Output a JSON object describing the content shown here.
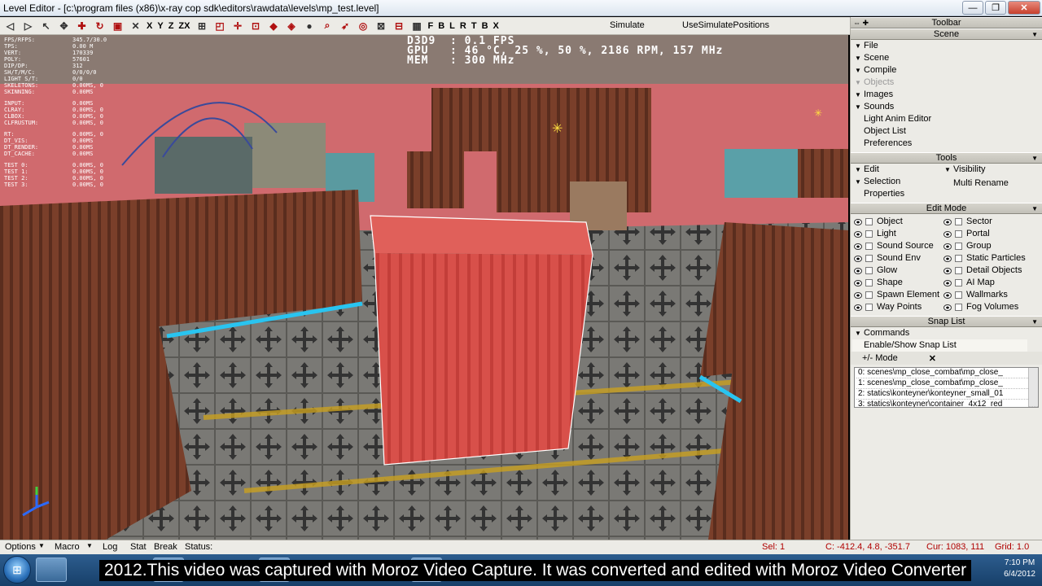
{
  "window": {
    "title": "Level Editor - [c:\\program files (x86)\\x-ray cop sdk\\editors\\rawdata\\levels\\mp_test.level]",
    "minimize": "—",
    "maximize": "❐",
    "close": "✕"
  },
  "toolbar": {
    "axis_letters": [
      "X",
      "Y",
      "Z",
      "ZX"
    ],
    "snap_letters": [
      "F",
      "B",
      "L",
      "R",
      "T",
      "B",
      "X"
    ],
    "simulate": "Simulate",
    "use_simulate_positions": "UseSimulatePositions"
  },
  "stats": {
    "rows": [
      {
        "k": "FPS/RFPS:",
        "v": "345.7/30.0"
      },
      {
        "k": "TPS:",
        "v": "0.00 M"
      },
      {
        "k": "VERT:",
        "v": "170339"
      },
      {
        "k": "POLY:",
        "v": "57601"
      },
      {
        "k": "DIP/DP:",
        "v": "312"
      },
      {
        "k": "SH/T/M/C:",
        "v": "0/0/0/0"
      },
      {
        "k": "LIGHT S/T:",
        "v": "0/0"
      },
      {
        "k": "SKELETONS:",
        "v": "0.00MS, 0"
      },
      {
        "k": "SKINNING:",
        "v": "0.00MS"
      },
      {
        "k": "INPUT:",
        "v": "0.00MS",
        "gap": true
      },
      {
        "k": "CLRAY:",
        "v": "0.00MS, 0"
      },
      {
        "k": "CLBOX:",
        "v": "0.00MS, 0"
      },
      {
        "k": "CLFRUSTUM:",
        "v": "0.00MS, 0"
      },
      {
        "k": " RT:",
        "v": "0.00MS, 0",
        "gap": true
      },
      {
        "k": " DT_VIS:",
        "v": "0.00MS"
      },
      {
        "k": " DT_RENDER:",
        "v": "0.00MS"
      },
      {
        "k": " DT_CACHE:",
        "v": "0.00MS"
      },
      {
        "k": "TEST 0:",
        "v": "0.00MS, 0",
        "gap": true
      },
      {
        "k": "TEST 1:",
        "v": "0.00MS, 0"
      },
      {
        "k": "TEST 2:",
        "v": "0.00MS, 0"
      },
      {
        "k": "TEST 3:",
        "v": "0.00MS, 0"
      }
    ],
    "hud": "D3D9  : 0.1 FPS\nGPU   : 46 °C, 25 %, 50 %, 2186 RPM, 157 MHz\nMEM   : 300 MHz"
  },
  "panel": {
    "toolbar_header": "Toolbar",
    "scene_header": "Scene",
    "scene_items": [
      {
        "label": "File",
        "tri": true
      },
      {
        "label": "Scene",
        "tri": true
      },
      {
        "label": "Compile",
        "tri": true
      },
      {
        "label": "Objects",
        "tri": true,
        "dim": true
      },
      {
        "label": "Images",
        "tri": true
      },
      {
        "label": "Sounds",
        "tri": true
      },
      {
        "label": "Light Anim Editor",
        "tri": false
      },
      {
        "label": "Object List",
        "tri": false
      },
      {
        "label": "Preferences",
        "tri": false
      }
    ],
    "tools_header": "Tools",
    "tools": {
      "edit": "Edit",
      "visibility": "Visibility",
      "selection": "Selection",
      "multi_rename": "Multi Rename",
      "properties": "Properties"
    },
    "editmode_header": "Edit Mode",
    "editmode_left": [
      "Object",
      "Light",
      "Sound Source",
      "Sound Env",
      "Glow",
      "Shape",
      "Spawn Element",
      "Way Points"
    ],
    "editmode_right": [
      "Sector",
      "Portal",
      "Group",
      "Static Particles",
      "Detail Objects",
      "AI Map",
      "Wallmarks",
      "Fog Volumes"
    ],
    "snaplist_header": "Snap List",
    "commands": "Commands",
    "enable_show": "Enable/Show Snap List",
    "mode": "+/- Mode",
    "mode_close": "✕",
    "snap_entries": [
      "0: scenes\\mp_close_combat\\mp_close_",
      "1: scenes\\mp_close_combat\\mp_close_",
      "2: statics\\konteyner\\konteyner_small_01",
      "3: statics\\konteyner\\container_4x12_red"
    ]
  },
  "statusbar": {
    "options": "Options",
    "macro": "Macro",
    "log": "Log",
    "stat": "Stat",
    "break": "Break",
    "status": "Status:",
    "sel": "Sel: 1",
    "coords": "C: -412.4, 4.8, -351.7",
    "cur": "Cur: 1083, 111",
    "grid": "Grid: 1.0"
  },
  "taskbar": {
    "caption": "2012.This video was captured with Moroz Video Capture. It was converted and edited with Moroz Video Converter",
    "time": "7:10 PM",
    "date": "6/4/2012"
  }
}
